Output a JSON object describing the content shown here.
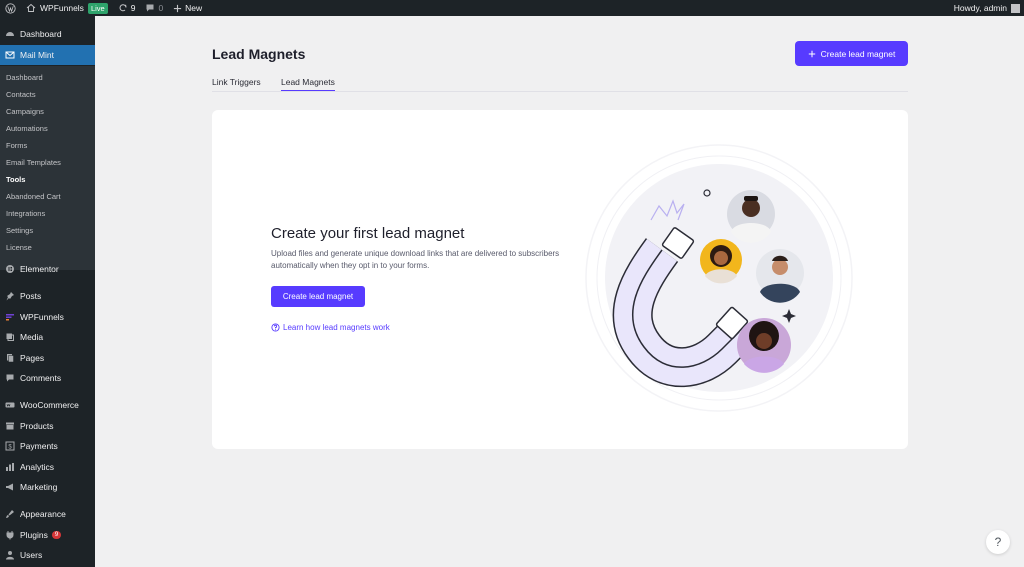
{
  "adminbar": {
    "site_name": "WPFunnels",
    "live_label": "Live",
    "updates_count": "9",
    "comments_count": "0",
    "new_label": "New",
    "greeting": "Howdy, admin"
  },
  "sidebar": {
    "dashboard": "Dashboard",
    "mail_mint": "Mail Mint",
    "submenu": [
      "Dashboard",
      "Contacts",
      "Campaigns",
      "Automations",
      "Forms",
      "Email Templates",
      "Tools",
      "Abandoned Cart",
      "Integrations",
      "Settings",
      "License"
    ],
    "current_sub": "Tools",
    "elementor": "Elementor",
    "posts": "Posts",
    "wpfunnels": "WPFunnels",
    "media": "Media",
    "pages": "Pages",
    "comments": "Comments",
    "woocommerce": "WooCommerce",
    "products": "Products",
    "payments": "Payments",
    "analytics": "Analytics",
    "marketing": "Marketing",
    "appearance": "Appearance",
    "plugins": "Plugins",
    "plugins_badge": "9",
    "users": "Users"
  },
  "page": {
    "title": "Lead Magnets",
    "create_button": "Create lead magnet",
    "tabs": [
      "Link Triggers",
      "Lead Magnets"
    ],
    "active_tab": "Lead Magnets"
  },
  "empty_state": {
    "title": "Create your first lead magnet",
    "description": "Upload files and generate unique download links that are delivered to subscribers automatically when they opt in to your forms.",
    "button": "Create lead magnet",
    "learn_link": "Learn how lead magnets work"
  },
  "help": "?",
  "colors": {
    "accent": "#573bff",
    "wp_dark": "#1d2327",
    "wp_active": "#2271b1",
    "submenu_bg": "#2c3338",
    "page_bg": "#f0f0f1"
  }
}
